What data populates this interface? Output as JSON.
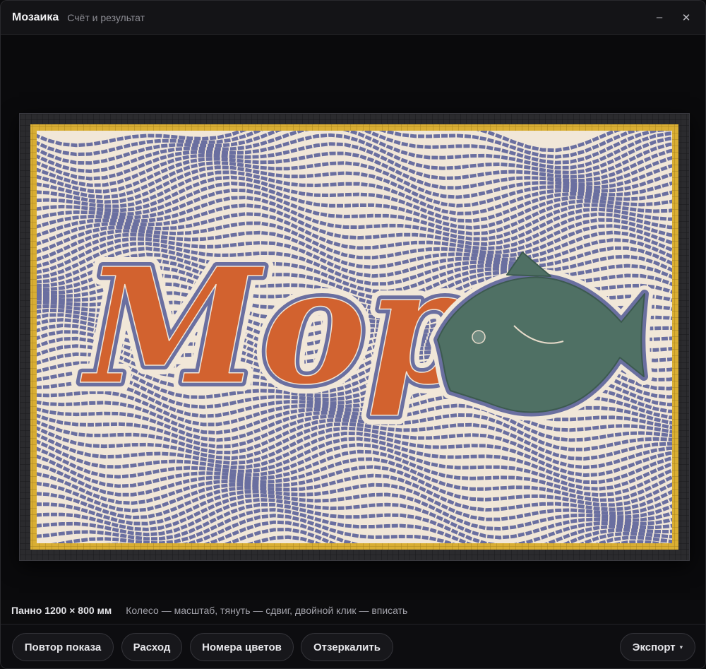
{
  "window": {
    "title": "Мозаика",
    "subtitle": "Счёт и результат",
    "minimize_icon": "minimize-icon",
    "close_icon": "close-icon"
  },
  "mosaic": {
    "text": "Море",
    "colors": {
      "background_tile": "#f1e7d8",
      "stripe": "#6a6fa0",
      "letters": "#d2622f",
      "fish": "#4f7064",
      "border_gold": "#d9ae33",
      "outer_dark": "#2b2b2e"
    }
  },
  "status": {
    "size_label": "Панно 1200 × 800 мм",
    "hint": "Колесо — масштаб, тянуть — сдвиг, двойной клик — вписать"
  },
  "toolbar": {
    "replay": "Повтор показа",
    "usage": "Расход",
    "color_numbers": "Номера цветов",
    "mirror": "Отзеркалить",
    "export": "Экспорт",
    "export_caret": "▾"
  }
}
